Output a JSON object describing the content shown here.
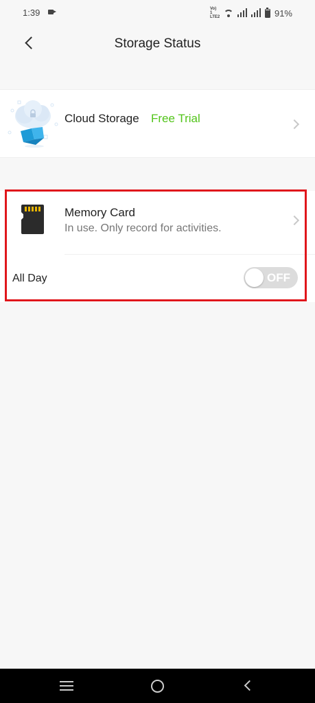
{
  "status_bar": {
    "time": "1:39",
    "network_label_line1": "Vo) 1",
    "network_label_line2": "LTE2",
    "battery": "91%"
  },
  "header": {
    "title": "Storage Status"
  },
  "cloud": {
    "title": "Cloud Storage",
    "badge": "Free Trial"
  },
  "memory": {
    "title": "Memory Card",
    "subtitle": "In use. Only record for activities.",
    "all_day_label": "All Day",
    "toggle_text": "OFF",
    "toggle_on": false
  },
  "colors": {
    "accent_green": "#52c41a",
    "highlight_red": "#e0161b",
    "toggle_off": "#dcdcdc"
  },
  "icons": {
    "back": "back-icon",
    "cloud": "cloud-storage-icon",
    "sd_card": "sd-card-icon",
    "chevron": "chevron-right-icon"
  }
}
